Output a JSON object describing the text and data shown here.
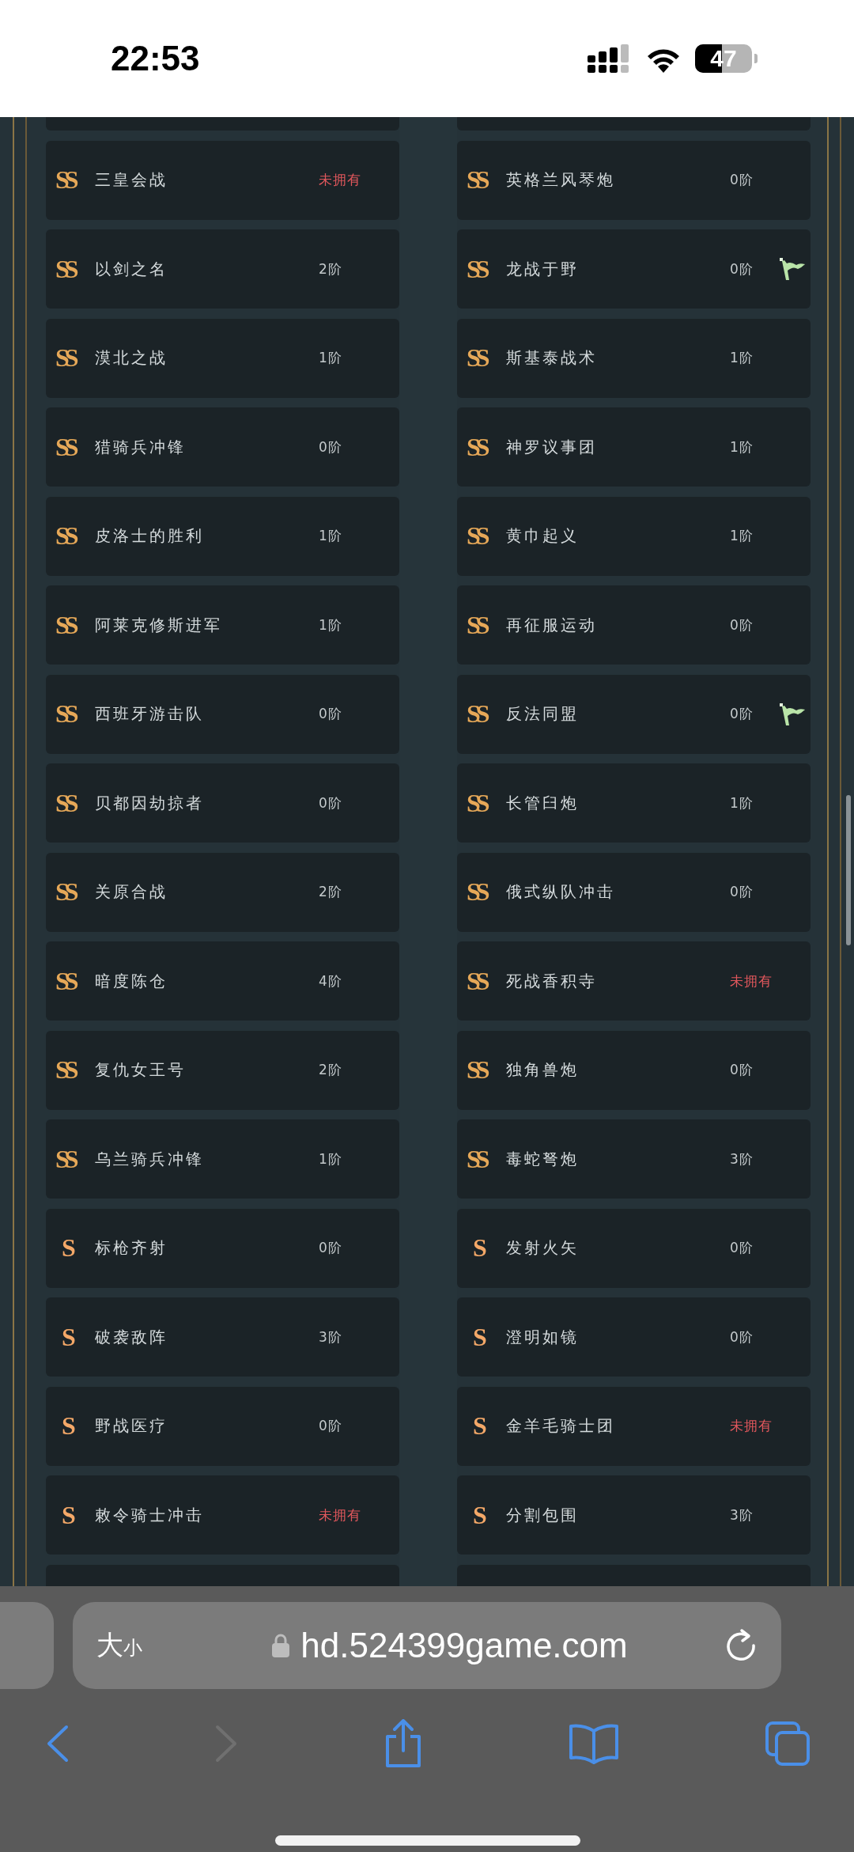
{
  "status_bar": {
    "time": "22:53",
    "battery": "47"
  },
  "cards": [
    {
      "rank": "SS",
      "name": "三皇会战",
      "status": "未拥有",
      "owned": false,
      "flagged": false
    },
    {
      "rank": "SS",
      "name": "英格兰风琴炮",
      "status": "0阶",
      "owned": true,
      "flagged": false
    },
    {
      "rank": "SS",
      "name": "以剑之名",
      "status": "2阶",
      "owned": true,
      "flagged": false
    },
    {
      "rank": "SS",
      "name": "龙战于野",
      "status": "0阶",
      "owned": true,
      "flagged": true
    },
    {
      "rank": "SS",
      "name": "漠北之战",
      "status": "1阶",
      "owned": true,
      "flagged": false
    },
    {
      "rank": "SS",
      "name": "斯基泰战术",
      "status": "1阶",
      "owned": true,
      "flagged": false
    },
    {
      "rank": "SS",
      "name": "猎骑兵冲锋",
      "status": "0阶",
      "owned": true,
      "flagged": false
    },
    {
      "rank": "SS",
      "name": "神罗议事团",
      "status": "1阶",
      "owned": true,
      "flagged": false
    },
    {
      "rank": "SS",
      "name": "皮洛士的胜利",
      "status": "1阶",
      "owned": true,
      "flagged": false
    },
    {
      "rank": "SS",
      "name": "黄巾起义",
      "status": "1阶",
      "owned": true,
      "flagged": false
    },
    {
      "rank": "SS",
      "name": "阿莱克修斯进军",
      "status": "1阶",
      "owned": true,
      "flagged": false
    },
    {
      "rank": "SS",
      "name": "再征服运动",
      "status": "0阶",
      "owned": true,
      "flagged": false
    },
    {
      "rank": "SS",
      "name": "西班牙游击队",
      "status": "0阶",
      "owned": true,
      "flagged": false
    },
    {
      "rank": "SS",
      "name": "反法同盟",
      "status": "0阶",
      "owned": true,
      "flagged": true
    },
    {
      "rank": "SS",
      "name": "贝都因劫掠者",
      "status": "0阶",
      "owned": true,
      "flagged": false
    },
    {
      "rank": "SS",
      "name": "长管臼炮",
      "status": "1阶",
      "owned": true,
      "flagged": false
    },
    {
      "rank": "SS",
      "name": "关原合战",
      "status": "2阶",
      "owned": true,
      "flagged": false
    },
    {
      "rank": "SS",
      "name": "俄式纵队冲击",
      "status": "0阶",
      "owned": true,
      "flagged": false
    },
    {
      "rank": "SS",
      "name": "暗度陈仓",
      "status": "4阶",
      "owned": true,
      "flagged": false
    },
    {
      "rank": "SS",
      "name": "死战香积寺",
      "status": "未拥有",
      "owned": false,
      "flagged": false
    },
    {
      "rank": "SS",
      "name": "复仇女王号",
      "status": "2阶",
      "owned": true,
      "flagged": false
    },
    {
      "rank": "SS",
      "name": "独角兽炮",
      "status": "0阶",
      "owned": true,
      "flagged": false
    },
    {
      "rank": "SS",
      "name": "乌兰骑兵冲锋",
      "status": "1阶",
      "owned": true,
      "flagged": false
    },
    {
      "rank": "SS",
      "name": "毒蛇弩炮",
      "status": "3阶",
      "owned": true,
      "flagged": false
    },
    {
      "rank": "S",
      "name": "标枪齐射",
      "status": "0阶",
      "owned": true,
      "flagged": false
    },
    {
      "rank": "S",
      "name": "发射火矢",
      "status": "0阶",
      "owned": true,
      "flagged": false
    },
    {
      "rank": "S",
      "name": "破袭敌阵",
      "status": "3阶",
      "owned": true,
      "flagged": false
    },
    {
      "rank": "S",
      "name": "澄明如镜",
      "status": "0阶",
      "owned": true,
      "flagged": false
    },
    {
      "rank": "S",
      "name": "野战医疗",
      "status": "0阶",
      "owned": true,
      "flagged": false
    },
    {
      "rank": "S",
      "name": "金羊毛骑士团",
      "status": "未拥有",
      "owned": false,
      "flagged": false
    },
    {
      "rank": "S",
      "name": "敕令骑士冲击",
      "status": "未拥有",
      "owned": false,
      "flagged": false
    },
    {
      "rank": "S",
      "name": "分割包围",
      "status": "3阶",
      "owned": true,
      "flagged": false
    }
  ],
  "browser": {
    "text_size_large": "大",
    "text_size_small": "小",
    "url": "hd.524399game.com"
  }
}
